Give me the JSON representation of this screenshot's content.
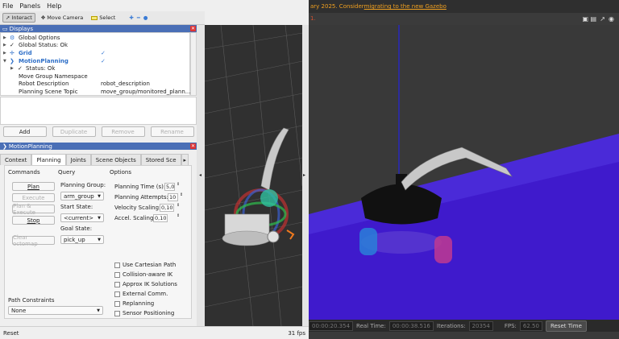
{
  "menubar": {
    "file": "File",
    "panels": "Panels",
    "help": "Help"
  },
  "toolbar": {
    "interact": "Interact",
    "move_camera": "Move Camera",
    "select": "Select"
  },
  "displays": {
    "title": "Displays",
    "rows": [
      {
        "name": "Global Options",
        "value": ""
      },
      {
        "name": "Global Status: Ok",
        "value": ""
      },
      {
        "name": "Grid",
        "value": "✓"
      },
      {
        "name": "MotionPlanning",
        "value": "✓"
      },
      {
        "name": "Status: Ok",
        "value": ""
      },
      {
        "name": "Move Group Namespace",
        "value": ""
      },
      {
        "name": "Robot Description",
        "value": "robot_description"
      },
      {
        "name": "Planning Scene Topic",
        "value": "move_group/monitored_plann..."
      }
    ],
    "buttons": {
      "add": "Add",
      "duplicate": "Duplicate",
      "remove": "Remove",
      "rename": "Rename"
    }
  },
  "motion_planning": {
    "title": "MotionPlanning",
    "tabs": [
      "Context",
      "Planning",
      "Joints",
      "Scene Objects",
      "Stored Sce"
    ],
    "commands_label": "Commands",
    "query_label": "Query",
    "options_label": "Options",
    "buttons": {
      "plan": "Plan",
      "execute": "Execute",
      "plan_execute": "Plan & Execute",
      "stop": "Stop",
      "clear_octomap": "Clear octomap"
    },
    "planning_group_label": "Planning Group:",
    "planning_group": "arm_group",
    "start_state_label": "Start State:",
    "start_state": "<current>",
    "goal_state_label": "Goal State:",
    "goal_state": "pick_up",
    "planning_time_label": "Planning Time (s):",
    "planning_time": "5,0",
    "planning_attempts_label": "Planning Attempts:",
    "planning_attempts": "10",
    "velocity_scaling_label": "Velocity Scaling:",
    "velocity_scaling": "0,10",
    "accel_scaling_label": "Accel. Scaling:",
    "accel_scaling": "0,10",
    "checkboxes": [
      "Use Cartesian Path",
      "Collision-aware IK",
      "Approx IK Solutions",
      "External Comm.",
      "Replanning",
      "Sensor Positioning"
    ],
    "path_constraints_label": "Path Constraints",
    "path_constraints": "None"
  },
  "statusbar": {
    "reset": "Reset",
    "fps": "31 fps"
  },
  "gazebo": {
    "banner_text": "ary 2025. Consider ",
    "banner_link": "migrating to the new Gazebo",
    "sim_time": "00:00:20.354",
    "real_time_label": "Real Time:",
    "real_time": "00:00:38.516",
    "iterations_label": "Iterations:",
    "iterations": "20354",
    "fps_label": "FPS:",
    "fps": "62.50",
    "reset_time": "Reset Time"
  }
}
